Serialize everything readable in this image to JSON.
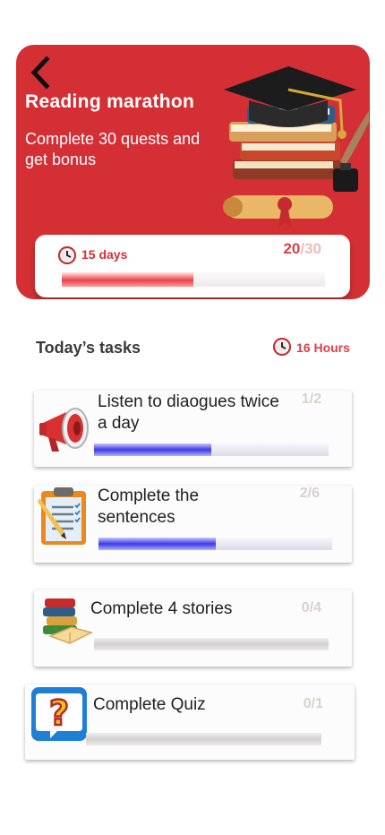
{
  "hero": {
    "title": "Reading marathon",
    "subtitle": "Complete 30 quests and get bonus",
    "days_left": "15 days",
    "completed": "20",
    "total": "/30",
    "progress_fraction": 0.5,
    "icons": [
      "back-arrow-icon",
      "graduation-cap-icon",
      "clock-icon"
    ],
    "colors": {
      "primary": "#d42f35",
      "accent": "#e9424a"
    }
  },
  "tasks": {
    "title": "Today’s tasks",
    "time_left": "16 Hours",
    "items": [
      {
        "text": "Listen to diaogues twice a day",
        "count": "1/2",
        "progress": 0.5,
        "icon": "megaphone-icon"
      },
      {
        "text": "Complete the sentences",
        "count": "2/6",
        "progress": 0.5,
        "icon": "clipboard-icon"
      },
      {
        "text": "Complete 4 stories",
        "count": "0/4",
        "progress": 0,
        "icon": "books-icon"
      },
      {
        "text": "Complete Quiz",
        "count": "0/1",
        "progress": 0,
        "icon": "question-icon"
      }
    ]
  }
}
